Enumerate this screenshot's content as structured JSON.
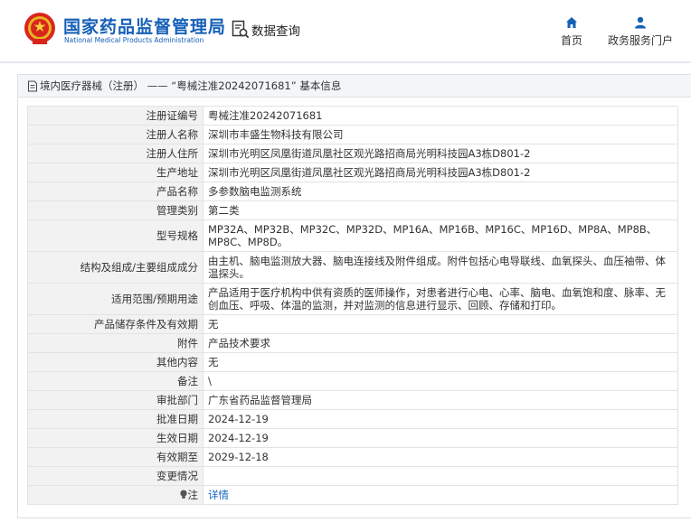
{
  "header": {
    "agency_name_cn": "国家药品监督管理局",
    "agency_name_en": "National Medical Products Administration",
    "query_label": "数据查询",
    "nav": [
      {
        "label": "首页",
        "icon": "home-icon"
      },
      {
        "label": "政务服务门户",
        "icon": "user-icon"
      }
    ]
  },
  "breadcrumb": {
    "text": "境内医疗器械（注册） —— “粤械注准20242071681” 基本信息"
  },
  "record": {
    "rows": [
      {
        "key": "注册证编号",
        "value": "粤械注准20242071681"
      },
      {
        "key": "注册人名称",
        "value": "深圳市丰盛生物科技有限公司"
      },
      {
        "key": "注册人住所",
        "value": "深圳市光明区凤凰街道凤凰社区观光路招商局光明科技园A3栋D801-2"
      },
      {
        "key": "生产地址",
        "value": "深圳市光明区凤凰街道凤凰社区观光路招商局光明科技园A3栋D801-2"
      },
      {
        "key": "产品名称",
        "value": "多参数脑电监测系统"
      },
      {
        "key": "管理类别",
        "value": "第二类"
      },
      {
        "key": "型号规格",
        "value": "MP32A、MP32B、MP32C、MP32D、MP16A、MP16B、MP16C、MP16D、MP8A、MP8B、MP8C、MP8D。"
      },
      {
        "key": "结构及组成/主要组成成分",
        "value": "由主机、脑电监测放大器、脑电连接线及附件组成。附件包括心电导联线、血氧探头、血压袖带、体温探头。"
      },
      {
        "key": "适用范围/预期用途",
        "value": "产品适用于医疗机构中供有资质的医师操作，对患者进行心电、心率、脑电、血氧饱和度、脉率、无创血压、呼吸、体温的监测，并对监测的信息进行显示、回顾、存储和打印。"
      },
      {
        "key": "产品储存条件及有效期",
        "value": "无"
      },
      {
        "key": "附件",
        "value": "产品技术要求"
      },
      {
        "key": "其他内容",
        "value": "无"
      },
      {
        "key": "备注",
        "value": "\\"
      },
      {
        "key": "审批部门",
        "value": "广东省药品监督管理局"
      },
      {
        "key": "批准日期",
        "value": "2024-12-19"
      },
      {
        "key": "生效日期",
        "value": "2024-12-19"
      },
      {
        "key": "有效期至",
        "value": "2029-12-18"
      },
      {
        "key": "变更情况",
        "value": ""
      }
    ],
    "note_key": "注",
    "note_link": "详情"
  }
}
